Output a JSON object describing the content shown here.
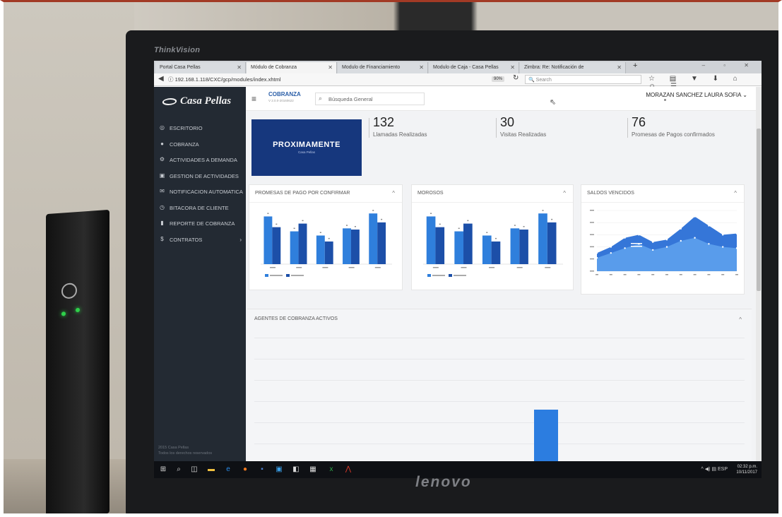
{
  "monitor": {
    "top_brand": "ThinkVision",
    "bottom_brand": "lenovo"
  },
  "browser": {
    "tabs": [
      {
        "label": "Portal Casa Pellas",
        "active": false
      },
      {
        "label": "Módulo de Cobranza",
        "active": true
      },
      {
        "label": "Modulo de Financiamiento",
        "active": false
      },
      {
        "label": "Modulo de Caja - Casa Pellas",
        "active": false
      },
      {
        "label": "Zimbra: Re: Notificación de",
        "active": false
      }
    ],
    "url": "192.168.1.118/CXC/gcp/modules/index.xhtml",
    "zoom": "90%",
    "search_placeholder": "Search"
  },
  "app": {
    "brand": "Casa Pellas",
    "module": "COBRANZA",
    "module_sub": "V 2.0.0-20160622",
    "search_placeholder": "Búsqueda General",
    "user": "MORAZAN SANCHEZ LAURA SOFIA"
  },
  "sidebar": {
    "items": [
      {
        "label": "ESCRITORIO",
        "icon": "gauge-icon"
      },
      {
        "label": "COBRANZA",
        "icon": "money-icon"
      },
      {
        "label": "ACTIVIDADES A DEMANDA",
        "icon": "gear-icon"
      },
      {
        "label": "GESTION DE ACTIVIDADES",
        "icon": "briefcase-icon"
      },
      {
        "label": "NOTIFICACION AUTOMATICA",
        "icon": "envelope-icon"
      },
      {
        "label": "BITACORA DE CLIENTE",
        "icon": "clock-user-icon"
      },
      {
        "label": "REPORTE DE COBRANZA",
        "icon": "trash-report-icon"
      },
      {
        "label": "CONTRATOS",
        "icon": "currency-icon"
      }
    ],
    "footer_line1": "2015 Casa Pellas",
    "footer_line2": "Todos los derechos reservados"
  },
  "dashboard": {
    "promo_title": "PROXIMAMENTE",
    "promo_sub": "Casa Pellas",
    "stats": [
      {
        "value": "132",
        "label": "Llamadas Realizadas"
      },
      {
        "value": "30",
        "label": "Visitas Realizadas"
      },
      {
        "value": "76",
        "label": "Promesas de Pagos confirmados"
      }
    ],
    "cards": [
      {
        "title": "PROMESAS DE PAGO POR CONFIRMAR"
      },
      {
        "title": "MOROSOS"
      },
      {
        "title": "SALDOS VENCIDOS"
      }
    ],
    "agents_title": "AGENTES DE COBRANZA ACTIVOS"
  },
  "chart_data": [
    {
      "type": "bar",
      "categories": [
        "",
        "",
        "",
        "",
        ""
      ],
      "series": [
        {
          "values": [
            80,
            55,
            48,
            60,
            85
          ]
        },
        {
          "values": [
            62,
            68,
            38,
            58,
            70
          ]
        }
      ],
      "colors": [
        "#2f7fdc",
        "#1c4fa8"
      ]
    },
    {
      "type": "bar",
      "categories": [
        "",
        "",
        "",
        "",
        ""
      ],
      "series": [
        {
          "values": [
            80,
            55,
            48,
            60,
            85
          ]
        },
        {
          "values": [
            62,
            68,
            38,
            58,
            70
          ]
        }
      ],
      "colors": [
        "#2f7fdc",
        "#1c4fa8"
      ]
    },
    {
      "type": "area",
      "x": [
        1,
        2,
        3,
        4,
        5,
        6,
        7,
        8,
        9,
        10,
        11
      ],
      "series": [
        {
          "values": [
            30,
            40,
            55,
            60,
            48,
            52,
            70,
            90,
            75,
            60,
            62
          ]
        },
        {
          "values": [
            22,
            30,
            38,
            45,
            35,
            40,
            50,
            55,
            45,
            40,
            38
          ]
        }
      ],
      "colors": [
        "#2a6fd6",
        "#5fa3ef"
      ]
    }
  ],
  "taskbar": {
    "lang": "ESP",
    "time": "02:32 p.m.",
    "date": "10/11/2017"
  }
}
